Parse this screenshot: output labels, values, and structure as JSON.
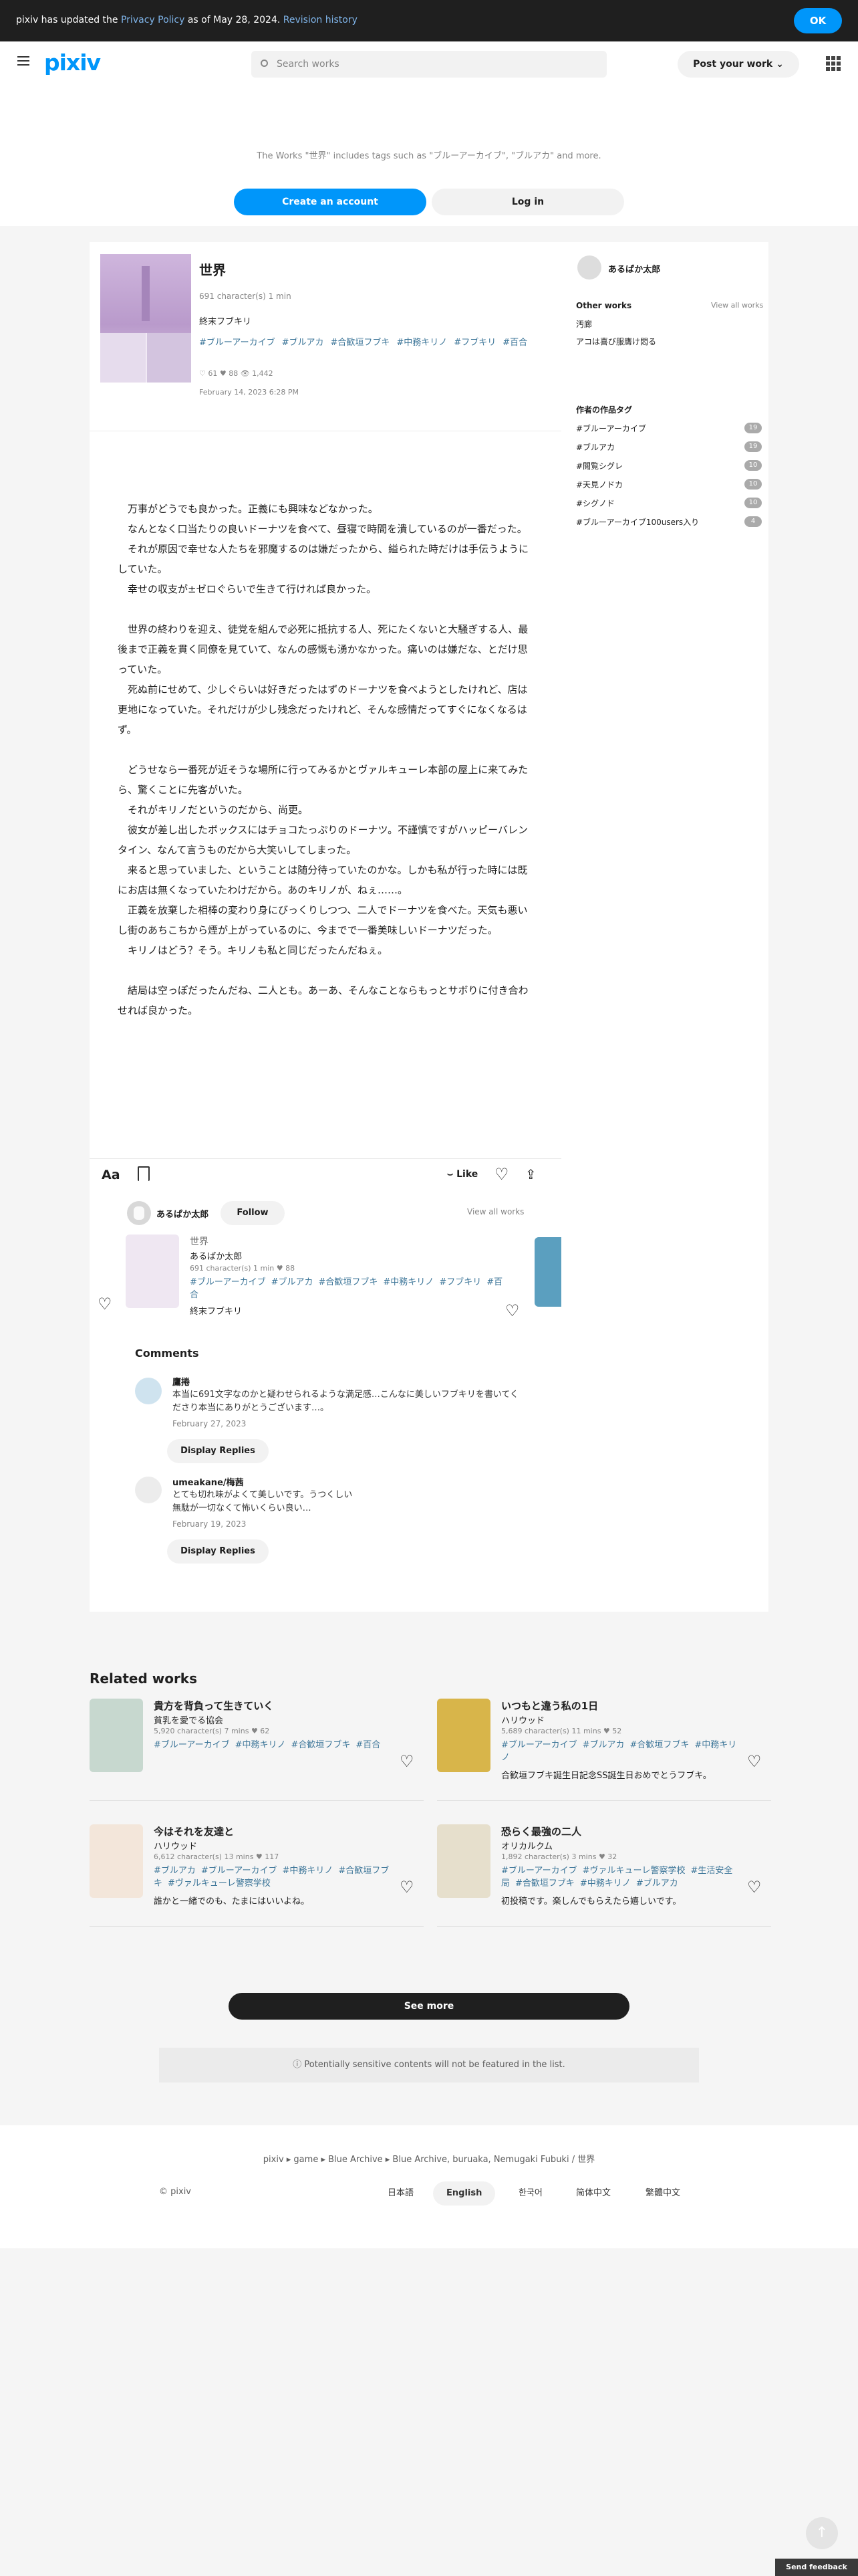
{
  "banner": {
    "prefix": "pixiv has updated the ",
    "link": "Privacy Policy",
    "middle": " as of May 28, 2024. ",
    "revision": "Revision history",
    "ok": "OK"
  },
  "header": {
    "logo": "pixiv",
    "search_placeholder": "Search works",
    "post": "Post your work"
  },
  "top": {
    "note": "The Works \"世界\" includes tags such as \"ブルーアーカイブ\", \"ブルアカ\" and more.",
    "create": "Create an account",
    "login": "Log in"
  },
  "work": {
    "title": "世界",
    "meta": "691 character(s)  1 min",
    "series": "終末フブキリ",
    "tags": [
      "#ブルーアーカイブ",
      "#ブルアカ",
      "#合歓垣フブキ",
      "#中務キリノ",
      "#フブキリ",
      "#百合"
    ],
    "stats": "♡ 61   ♥ 88   👁 1,442",
    "date": "February 14, 2023 6:28 PM"
  },
  "story": [
    "　万事がどうでも良かった。正義にも興味などなかった。",
    "　なんとなく口当たりの良いドーナツを食べて、昼寝で時間を潰しているのが一番だった。",
    "　それが原因で幸せな人たちを邪魔するのは嫌だったから、縊られた時だけは手伝うようにしていた。",
    "　幸せの収支が±ゼロぐらいで生きて行ければ良かった。",
    "",
    "　世界の終わりを迎え、徒党を組んで必死に抵抗する人、死にたくないと大騒ぎする人、最後まで正義を貫く同僚を見ていて、なんの感慨も湧かなかった。痛いのは嫌だな、とだけ思っていた。",
    "　死ぬ前にせめて、少しぐらいは好きだったはずのドーナツを食べようとしたけれど、店は更地になっていた。それだけが少し残念だったけれど、そんな感情だってすぐになくなるはず。",
    "",
    "　どうせなら一番死が近そうな場所に行ってみるかとヴァルキューレ本部の屋上に来てみたら、驚くことに先客がいた。",
    "　それがキリノだというのだから、尚更。",
    "　彼女が差し出したボックスにはチョコたっぷりのドーナツ。不謹慎ですがハッピーバレンタイン、なんて言うものだから大笑いしてしまった。",
    "　来ると思っていました、ということは随分待っていたのかな。しかも私が行った時には既にお店は無くなっていたわけだから。あのキリノが、ねぇ……。",
    "　正義を放棄した相棒の変わり身にびっくりしつつ、二人でドーナツを食べた。天気も悪いし街のあちこちから煙が上がっているのに、今までで一番美味しいドーナツだった。",
    "　キリノはどう？そう。キリノも私と同じだったんだねぇ。",
    "",
    "　結局は空っぽだったんだね、二人とも。あーあ、そんなことならもっとサボりに付き合わせれば良かった。"
  ],
  "toolbar": {
    "aa": "Aa",
    "like": "Like"
  },
  "author": {
    "name": "あるぱか太郎",
    "follow": "Follow",
    "view_all": "View all works"
  },
  "card": {
    "title": "世界",
    "author": "あるぱか太郎",
    "meta": "691 character(s)  1 min  ♥ 88",
    "tags": [
      "#ブルーアーカイブ",
      "#ブルアカ",
      "#合歓垣フブキ",
      "#中務キリノ",
      "#フブキリ",
      "#百合"
    ],
    "series": "終末フブキリ"
  },
  "comments": {
    "heading": "Comments",
    "items": [
      {
        "name": "鷹捲",
        "text": "本当に691文字なのかと疑わせられるような満足感…こんなに美しいフブキリを書いてくださり本当にありがとうございます…。",
        "date": "February 27, 2023",
        "button": "Display Replies"
      },
      {
        "name": "umeakane/梅茜",
        "text": "とても切れ味がよくて美しいです。うつくしい\n無駄が一切なくて怖いくらい良い…",
        "date": "February 19, 2023",
        "button": "Display Replies"
      }
    ]
  },
  "sidebar": {
    "author": "あるぱか太郎",
    "other_works": "Other works",
    "view_all": "View all works",
    "works": [
      "汚廊",
      "アコは喜び服膺け悶る"
    ],
    "tags_heading": "作者の作品タグ",
    "tags": [
      {
        "name": "#ブルーアーカイブ",
        "count": "19"
      },
      {
        "name": "#ブルアカ",
        "count": "19"
      },
      {
        "name": "#閲覧シグレ",
        "count": "10"
      },
      {
        "name": "#天見ノドカ",
        "count": "10"
      },
      {
        "name": "#シグノド",
        "count": "10"
      },
      {
        "name": "#ブルーアーカイブ100users入り",
        "count": "4"
      }
    ]
  },
  "related": {
    "heading": "Related works",
    "items": [
      {
        "title": "貴方を背負って生きていく",
        "author": "貧乳を愛でる協会",
        "meta": "5,920 character(s)  7 mins  ♥ 62",
        "tags": [
          "#ブルーアーカイブ",
          "#中務キリノ",
          "#合歓垣フブキ",
          "#百合"
        ],
        "summary": "",
        "color": "#c7d8cf"
      },
      {
        "title": "いつもと違う私の1日",
        "author": "ハリウッド",
        "meta": "5,689 character(s)  11 mins  ♥ 52",
        "tags": [
          "#ブルーアーカイブ",
          "#ブルアカ",
          "#合歓垣フブキ",
          "#中務キリノ"
        ],
        "summary": "合歓垣フブキ誕生日記念SS誕生日おめでとうフブキ。",
        "color": "#d8b54a"
      },
      {
        "title": "今はそれを友達と",
        "author": "ハリウッド",
        "meta": "6,612 character(s)  13 mins  ♥ 117",
        "tags": [
          "#ブルアカ",
          "#ブルーアーカイブ",
          "#中務キリノ",
          "#合歓垣フブキ",
          "#ヴァルキューレ警察学校"
        ],
        "summary": "誰かと一緒でのも、たまにはいいよね。",
        "color": "#f3e6da"
      },
      {
        "title": "恐らく最強の二人",
        "author": "オリカルクム",
        "meta": "1,892 character(s)  3 mins  ♥ 32",
        "tags": [
          "#ブルーアーカイブ",
          "#ヴァルキューレ警察学校",
          "#生活安全局",
          "#合歓垣フブキ",
          "#中務キリノ",
          "#ブルアカ"
        ],
        "summary": "初投稿です。楽しんでもらえたら嬉しいです。",
        "color": "#e6dfcc"
      }
    ],
    "see_more": "See more",
    "notice": "Potentially sensitive contents will not be featured in the list."
  },
  "footer": {
    "breadcrumb": "pixiv  ▸  game  ▸  Blue Archive  ▸  Blue Archive, buruaka, Nemugaki Fubuki / 世界",
    "copyright": "© pixiv",
    "languages": [
      "日本語",
      "English",
      "한국어",
      "简体中文",
      "繁體中文"
    ],
    "feedback": "Send feedback"
  }
}
